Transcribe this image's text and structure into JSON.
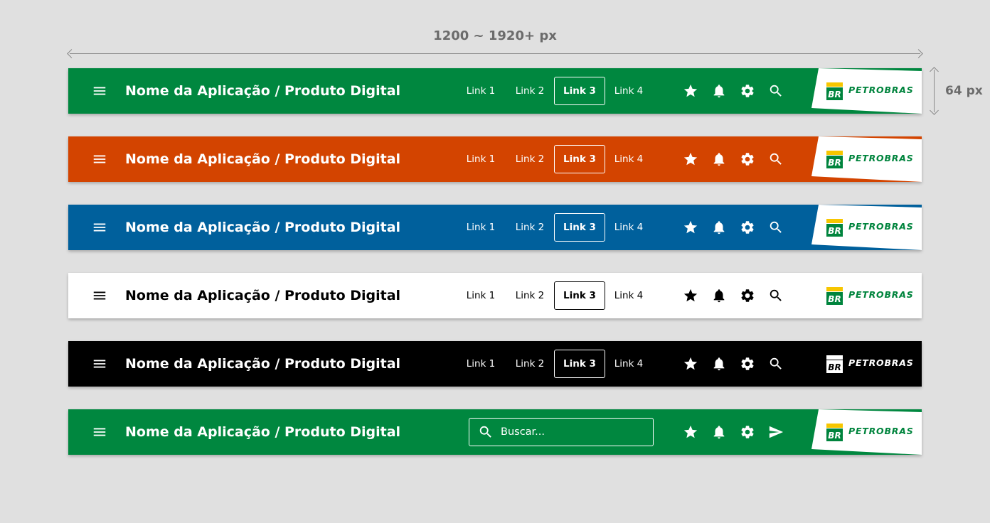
{
  "dimensions": {
    "width_label": "1200 ~ 1920+ px",
    "height_label": "64 px"
  },
  "app_title": "Nome da Aplicação / Produto Digital",
  "links": [
    "Link 1",
    "Link 2",
    "Link 3",
    "Link 4"
  ],
  "active_link_index": 2,
  "search": {
    "placeholder": "Buscar..."
  },
  "logo": {
    "mark_text": "BR",
    "brand_text": "PETROBRAS"
  },
  "icons": [
    "star-icon",
    "bell-icon",
    "gear-icon",
    "search-icon",
    "send-icon"
  ],
  "variants": [
    {
      "name": "green",
      "background": "#00873f",
      "foreground": "#ffffff"
    },
    {
      "name": "orange",
      "background": "#d34400",
      "foreground": "#ffffff"
    },
    {
      "name": "blue",
      "background": "#00609c",
      "foreground": "#ffffff"
    },
    {
      "name": "white",
      "background": "#ffffff",
      "foreground": "#000000"
    },
    {
      "name": "black",
      "background": "#000000",
      "foreground": "#ffffff"
    },
    {
      "name": "green-search",
      "background": "#00873f",
      "foreground": "#ffffff"
    }
  ],
  "brand_colors": {
    "green": "#00843d",
    "yellow": "#f7c600"
  }
}
